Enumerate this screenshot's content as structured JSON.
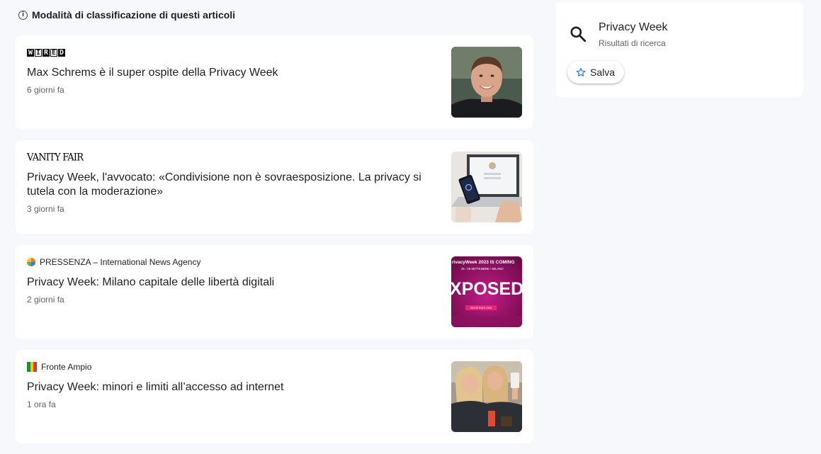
{
  "header": {
    "ranking_label": "Modalità di classificazione di questi articoli"
  },
  "articles": [
    {
      "source": "WIRED",
      "title": "Max Schrems è il super ospite della Privacy Week",
      "time": "6 giorni fa"
    },
    {
      "source": "VANITY FAIR",
      "title": "Privacy Week, l'avvocato: «Condivisione non è sovraesposizione. La privacy si tutela con la moderazione»",
      "time": "3 giorni fa"
    },
    {
      "source": "PRESSENZA – International News Agency",
      "title": "Privacy Week: Milano capitale delle libertà digitali",
      "time": "2 giorni fa",
      "thumb_text": {
        "line1": "rivacyWeek  2023 IS COMING",
        "line2": "25 - 29 SETTEMBRE • MILANO",
        "big": "XPOSED",
        "button": "REGISTRATI ORA"
      }
    },
    {
      "source": "Fronte Ampio",
      "title": "Privacy Week: minori e limiti all’accesso ad internet",
      "time": "1 ora fa"
    }
  ],
  "panel": {
    "title": "Privacy Week",
    "subtitle": "Risultati di ricerca",
    "save_label": "Salva"
  },
  "colors": {
    "background": "#f6f8fc",
    "card": "#ffffff",
    "secondary_text": "#5f6368",
    "star_blue": "#1a73e8",
    "pressenza_magenta": "#a0146e"
  },
  "icons": [
    "info-icon",
    "search-icon",
    "star-icon"
  ]
}
